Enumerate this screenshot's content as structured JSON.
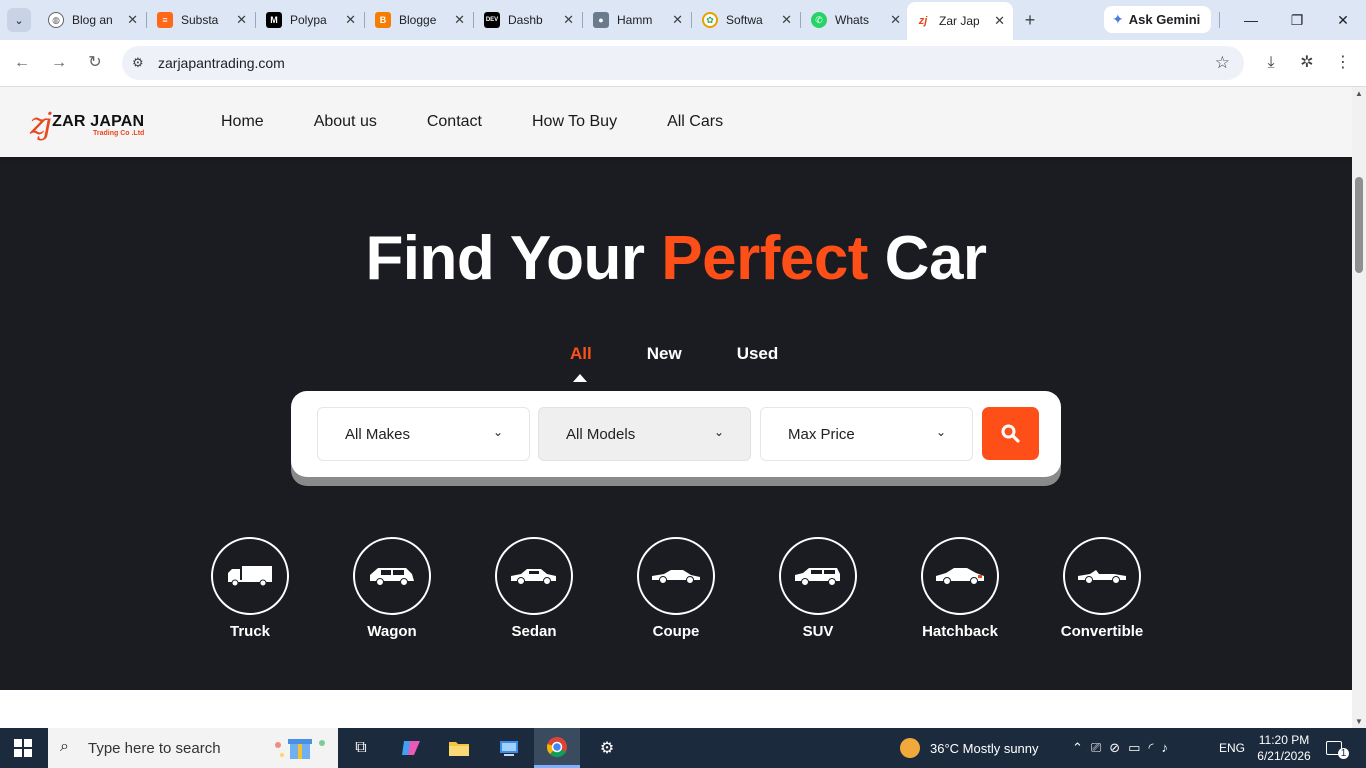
{
  "browser": {
    "tabs": [
      {
        "title": "Blog an",
        "favicon": "globe-icon",
        "color": "#5f6368"
      },
      {
        "title": "Substa",
        "favicon": "substack-icon",
        "color": "#ff6719"
      },
      {
        "title": "Polypa",
        "favicon": "medium-icon",
        "color": "#000000"
      },
      {
        "title": "Blogge",
        "favicon": "blogger-icon",
        "color": "#f57d00"
      },
      {
        "title": "Dashb",
        "favicon": "dev-icon",
        "color": "#000000"
      },
      {
        "title": "Hamm",
        "favicon": "avatar-icon",
        "color": "#6b7b8c"
      },
      {
        "title": "Softwa",
        "favicon": "software-icon",
        "color": "#e8a000"
      },
      {
        "title": "Whats",
        "favicon": "whatsapp-icon",
        "color": "#25d366"
      },
      {
        "title": "Zar Jap",
        "favicon": "zarjapan-icon",
        "color": "#e8481c"
      }
    ],
    "gemini_label": "Ask Gemini",
    "url": "zarjapantrading.com"
  },
  "site": {
    "logo": {
      "mark": "zj",
      "name": "ZAR JAPAN",
      "sub": "Trading Co .Ltd"
    },
    "nav": [
      "Home",
      "About us",
      "Contact",
      "How To Buy",
      "All Cars"
    ],
    "hero": {
      "title_before": "Find Your ",
      "title_accent": "Perfect",
      "title_after": " Car",
      "condition_tabs": [
        "All",
        "New",
        "Used"
      ],
      "active_condition": "All",
      "selects": {
        "make": "All Makes",
        "model": "All Models",
        "price": "Max Price"
      }
    },
    "body_types": [
      "Truck",
      "Wagon",
      "Sedan",
      "Coupe",
      "SUV",
      "Hatchback",
      "Convertible"
    ],
    "accent_color": "#fe4f18",
    "hero_bg": "#1b1c22"
  },
  "taskbar": {
    "search_placeholder": "Type here to search",
    "weather": "36°C  Mostly sunny",
    "language": "ENG",
    "time": "11:20 PM",
    "date": "6/21/2026",
    "notification_count": "1"
  }
}
